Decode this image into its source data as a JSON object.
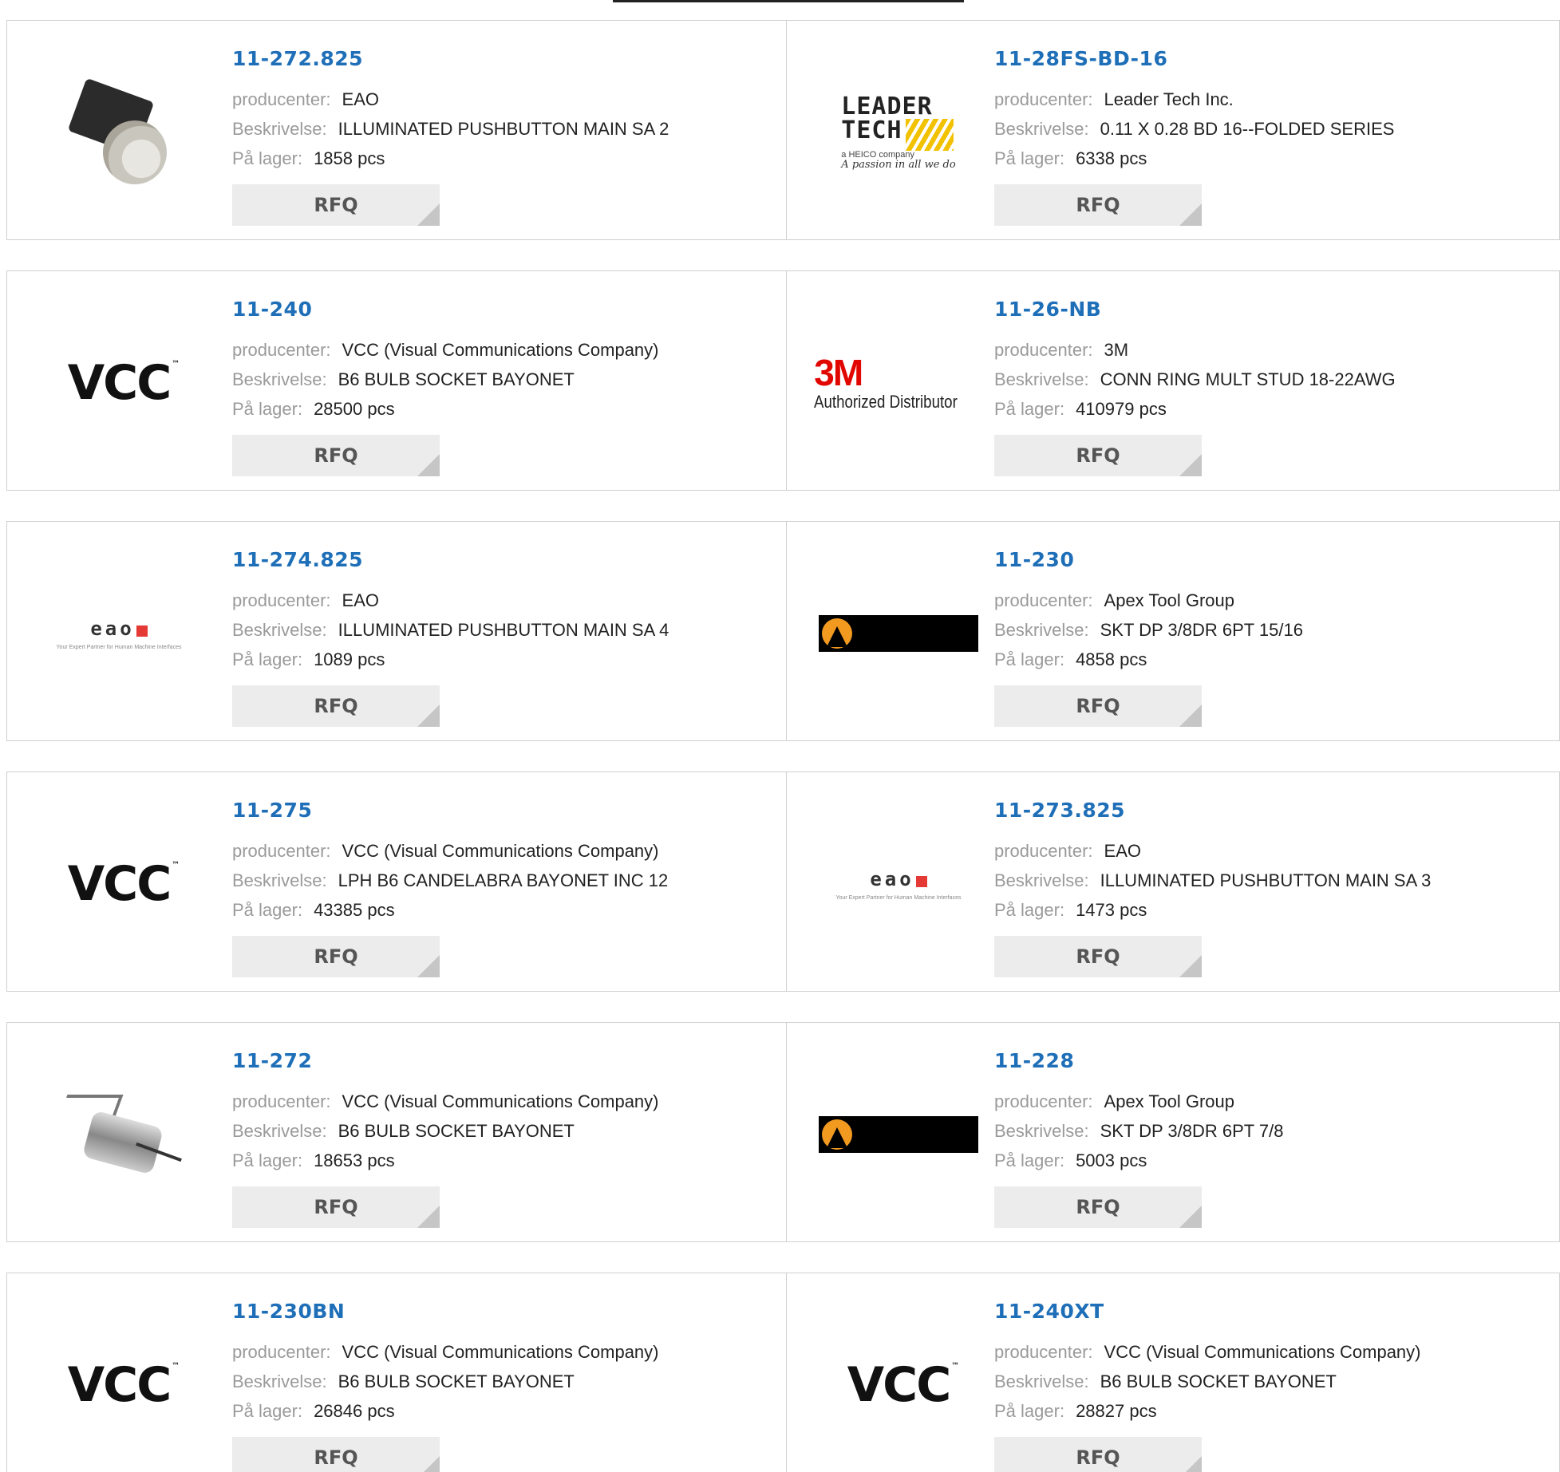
{
  "labels": {
    "manufacturer": "producenter:",
    "description": "Beskrivelse:",
    "stock": "På lager:",
    "rfq": "RFQ"
  },
  "rows": [
    [
      {
        "pn": "11-272.825",
        "mfr": "EAO",
        "desc": "ILLUMINATED PUSHBUTTON MAIN SA 2",
        "stock": "1858 pcs",
        "logo": "photo-switch"
      },
      {
        "pn": "11-28FS-BD-16",
        "mfr": "Leader Tech Inc.",
        "desc": "0.11 X 0.28 BD 16--FOLDED SERIES",
        "stock": "6338 pcs",
        "logo": "leader-tech"
      }
    ],
    [
      {
        "pn": "11-240",
        "mfr": "VCC (Visual Communications Company)",
        "desc": "B6 BULB SOCKET BAYONET",
        "stock": "28500 pcs",
        "logo": "vcc"
      },
      {
        "pn": "11-26-NB",
        "mfr": "3M",
        "desc": "CONN RING MULT STUD 18-22AWG",
        "stock": "410979 pcs",
        "logo": "3m"
      }
    ],
    [
      {
        "pn": "11-274.825",
        "mfr": "EAO",
        "desc": "ILLUMINATED PUSHBUTTON MAIN SA 4",
        "stock": "1089 pcs",
        "logo": "eao"
      },
      {
        "pn": "11-230",
        "mfr": "Apex Tool Group",
        "desc": "SKT DP 3/8DR 6PT 15/16",
        "stock": "4858 pcs",
        "logo": "apex"
      }
    ],
    [
      {
        "pn": "11-275",
        "mfr": "VCC (Visual Communications Company)",
        "desc": "LPH B6 CANDELABRA BAYONET INC 12",
        "stock": "43385 pcs",
        "logo": "vcc"
      },
      {
        "pn": "11-273.825",
        "mfr": "EAO",
        "desc": "ILLUMINATED PUSHBUTTON MAIN SA 3",
        "stock": "1473 pcs",
        "logo": "eao"
      }
    ],
    [
      {
        "pn": "11-272",
        "mfr": "VCC (Visual Communications Company)",
        "desc": "B6 BULB SOCKET BAYONET",
        "stock": "18653 pcs",
        "logo": "photo-socket"
      },
      {
        "pn": "11-228",
        "mfr": "Apex Tool Group",
        "desc": "SKT DP 3/8DR 6PT 7/8",
        "stock": "5003 pcs",
        "logo": "apex"
      }
    ],
    [
      {
        "pn": "11-230BN",
        "mfr": "VCC (Visual Communications Company)",
        "desc": "B6 BULB SOCKET BAYONET",
        "stock": "26846 pcs",
        "logo": "vcc"
      },
      {
        "pn": "11-240XT",
        "mfr": "VCC (Visual Communications Company)",
        "desc": "B6 BULB SOCKET BAYONET",
        "stock": "28827 pcs",
        "logo": "vcc"
      }
    ]
  ],
  "logos": {
    "vcc": "VCC",
    "eao": "eao",
    "eao_tag": "Your Expert Partner for Human Machine Interfaces",
    "3m": "3M",
    "3m_sub": "Authorized Distributor",
    "leader_l1": "LEADER",
    "leader_l2": "TECH",
    "leader_sub": "a HEICO company",
    "leader_script": "A passion in all we do"
  },
  "colors": {
    "part_number": "#1e6fb8",
    "label": "#9a9a9a",
    "button_bg": "#ececec"
  }
}
